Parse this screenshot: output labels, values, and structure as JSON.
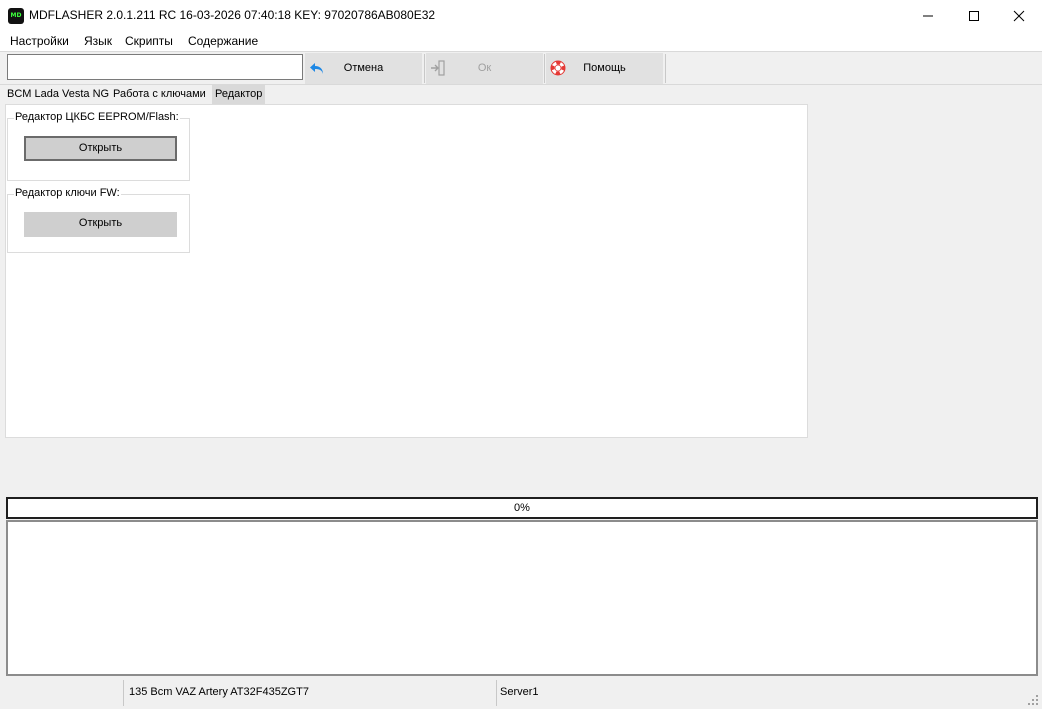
{
  "window": {
    "icon_text": "MD",
    "title": "MDFLASHER  2.0.1.211 RC 16-03-2026 07:40:18  KEY: 97020786AB080E32"
  },
  "menu": [
    "Настройки",
    "Язык",
    "Скрипты",
    "Содержание"
  ],
  "toolbar": {
    "input_value": "",
    "cancel_label": "Отмена",
    "ok_label": "Ок",
    "help_label": "Помощь"
  },
  "tabs": [
    {
      "label": "BCM Lada Vesta NG"
    },
    {
      "label": "Работа с ключами"
    },
    {
      "label": "Редактор"
    }
  ],
  "active_tab": "Редактор",
  "editor": {
    "group1": {
      "title": "Редактор ЦКБС EEPROM/Flash:",
      "button": "Открыть"
    },
    "group2": {
      "title": "Редактор ключи FW:",
      "button": "Открыть"
    }
  },
  "progress": {
    "value": 0,
    "text": "0%"
  },
  "status": {
    "device": "135 Bcm VAZ Artery AT32F435ZGT7",
    "server": "Server1"
  },
  "colors": {
    "progress_fill": "#06b025",
    "cancel_icon": "#1e88e5",
    "help_icon": "#e53935"
  },
  "icons": [
    "app-logo",
    "minimize-icon",
    "maximize-icon",
    "close-icon",
    "back-arrow-icon",
    "exit-icon",
    "lifebuoy-icon",
    "resize-grip-icon"
  ]
}
